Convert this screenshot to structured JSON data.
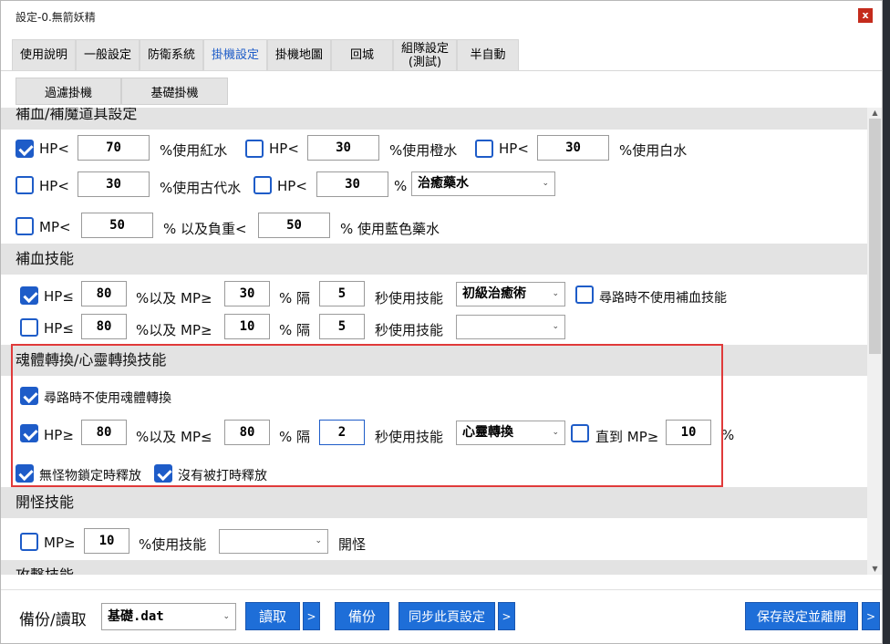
{
  "window": {
    "title": "設定-0.無箭妖精",
    "close": "x"
  },
  "tabs": [
    "使用說明",
    "一般設定",
    "防衛系統",
    "掛機設定",
    "掛機地圖",
    "回城",
    "組隊設定(測試)",
    "半自動"
  ],
  "subtabs": [
    "過濾掛機",
    "基礎掛機"
  ],
  "potions": {
    "heading": "補血/補魔道具設定",
    "row1": {
      "hp_label": "HP<",
      "a_value": "70",
      "a_text": "%使用紅水",
      "b_label": "HP<",
      "b_value": "30",
      "b_text": "%使用橙水",
      "c_label": "HP<",
      "c_value": "30",
      "c_text": "%使用白水"
    },
    "row2": {
      "a_label": "HP<",
      "a_value": "30",
      "a_text": "%使用古代水",
      "b_label": "HP<",
      "b_value": "30",
      "b_text": "%",
      "select": "治癒藥水"
    },
    "row3": {
      "label": "MP<",
      "value": "50",
      "text": "% 以及負重<",
      "weight": "50",
      "text2": "% 使用藍色藥水"
    }
  },
  "heal": {
    "heading": "補血技能",
    "row1": {
      "hp": "HP≤",
      "hp_value": "80",
      "mp": "%以及 MP≥",
      "mp_value": "30",
      "gap": "% 隔",
      "sec_value": "5",
      "use": "秒使用技能",
      "skill": "初級治癒術",
      "nopath": "尋路時不使用補血技能"
    },
    "row2": {
      "hp": "HP≤",
      "hp_value": "80",
      "mp": "%以及 MP≥",
      "mp_value": "10",
      "gap": "% 隔",
      "sec_value": "5",
      "use": "秒使用技能",
      "skill": ""
    }
  },
  "soul": {
    "heading": "魂體轉換/心靈轉換技能",
    "nopath": "尋路時不使用魂體轉換",
    "row": {
      "hp": "HP≥",
      "hp_value": "80",
      "mp": "%以及 MP≤",
      "mp_value": "80",
      "gap": "% 隔",
      "sec_value": "2",
      "use": "秒使用技能",
      "skill": "心靈轉換",
      "until": "直到 MP≥",
      "until_value": "10",
      "pct": "%"
    },
    "nomonster": "無怪物鎖定時釋放",
    "nohit": "沒有被打時釋放"
  },
  "open": {
    "heading": "開怪技能",
    "mp": "MP≥",
    "mp_value": "10",
    "use": "%使用技能",
    "skill": "",
    "suffix": "開怪"
  },
  "attack": {
    "heading": "攻擊技能"
  },
  "bottom": {
    "backup_label": "備份/讀取",
    "file": "基礎.dat",
    "read": "讀取",
    "more1": ">",
    "backup": "備份",
    "sync": "同步此頁設定",
    "more2": ">",
    "save": "保存設定並離開",
    "more3": ">"
  }
}
